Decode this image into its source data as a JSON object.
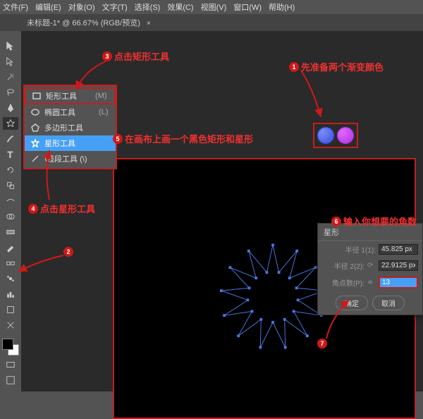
{
  "menu": {
    "file": "文件(F)",
    "edit": "编辑(E)",
    "object": "对象(O)",
    "type": "文字(T)",
    "select": "选择(S)",
    "effect": "效果(C)",
    "view": "视图(V)",
    "window": "窗口(W)",
    "help": "帮助(H)"
  },
  "tab": {
    "title": "未标题-1* @ 66.67% (RGB/预览)",
    "close": "×"
  },
  "flyout": {
    "rect": "矩形工具",
    "rect_sc": "(M)",
    "ellipse": "椭圆工具",
    "ellipse_sc": "(L)",
    "polygon": "多边形工具",
    "star": "星形工具",
    "line": "\\线段工具 (\\)"
  },
  "dialog": {
    "title": "星形",
    "r1_label": "半径 1(1):",
    "r1_value": "45.825 px",
    "r2_label": "半径 2(2):",
    "r2_value": "22.9125 px",
    "pts_label": "角点数(P):",
    "pts_value": "13",
    "ok": "确定",
    "cancel": "取消"
  },
  "anno": {
    "a1": "先准备两个渐变颜色",
    "a3": "点击矩形工具",
    "a4": "点击星形工具",
    "a5": "在画布上画一个黑色矩形和星形",
    "a6": "输入你想要的角数"
  }
}
